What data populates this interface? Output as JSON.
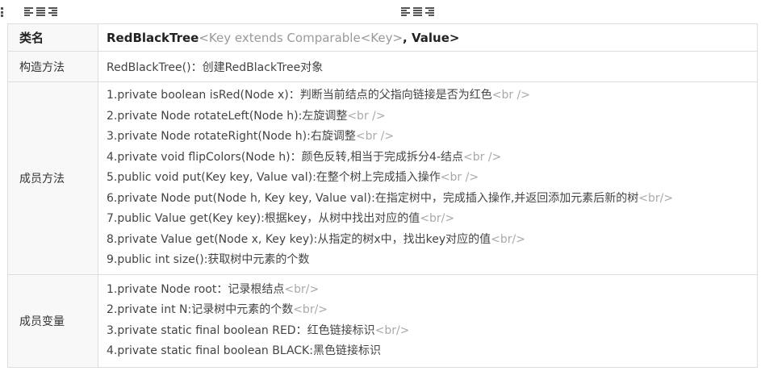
{
  "toolbar": {
    "left_align_icons": [
      "align-left-icon",
      "align-center-icon",
      "align-right-icon"
    ],
    "center_align_icons": [
      "align-left-icon",
      "align-center-icon",
      "align-right-icon"
    ]
  },
  "table": {
    "header": {
      "label": "类名",
      "class_name": "RedBlackTree",
      "generic": "<Key extends Comparable<Key>",
      "tail": ", Value>"
    },
    "constructor": {
      "label": "构造方法",
      "text": "RedBlackTree()：创建RedBlackTree对象"
    },
    "methods": {
      "label": "成员方法",
      "items": [
        {
          "text": "1.private boolean isRed(Node x)：判断当前结点的父指向链接是否为红色",
          "tag": "<br />"
        },
        {
          "text": "2.private Node rotateLeft(Node h):左旋调整",
          "tag": "<br />"
        },
        {
          "text": "3.private Node rotateRight(Node h):右旋调整",
          "tag": "<br />"
        },
        {
          "text": "4.private void flipColors(Node h)：颜色反转,相当于完成拆分4-结点",
          "tag": "<br />"
        },
        {
          "text": "5.public void put(Key key, Value val):在整个树上完成插入操作",
          "tag": "<br />"
        },
        {
          "text": "6.private Node put(Node h, Key key, Value val):在指定树中，完成插入操作,并返回添加元素后新的树",
          "tag": "<br/>"
        },
        {
          "text": "7.public Value get(Key key):根据key，从树中找出对应的值",
          "tag": "<br/>"
        },
        {
          "text": "8.private Value get(Node x, Key key):从指定的树x中，找出key对应的值",
          "tag": "<br/>"
        },
        {
          "text": "9.public int size():获取树中元素的个数",
          "tag": ""
        }
      ]
    },
    "variables": {
      "label": "成员变量",
      "items": [
        {
          "text": "1.private Node root：记录根结点",
          "tag": "<br/>"
        },
        {
          "text": "2.private int N:记录树中元素的个数",
          "tag": "<br/>"
        },
        {
          "text": "3.private static final boolean RED：红色链接标识",
          "tag": "<br/>"
        },
        {
          "text": "4.private static final boolean BLACK:黑色链接标识",
          "tag": ""
        }
      ]
    }
  }
}
